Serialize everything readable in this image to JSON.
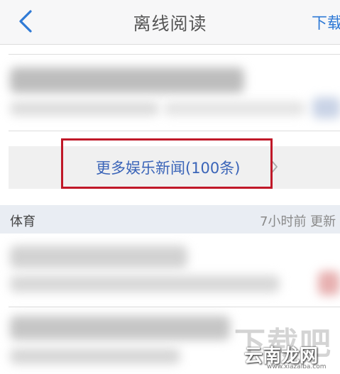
{
  "navbar": {
    "back_icon": "chevron-left-icon",
    "title": "离线阅读",
    "download_label": "下载"
  },
  "more_link": {
    "label": "更多娱乐新闻(100条)",
    "chevron_icon": "chevron-right-icon"
  },
  "section": {
    "title": "体育",
    "meta": "7小时前 更新"
  },
  "watermark": {
    "big_text": "下载吧",
    "main_text": "云南龙网",
    "url": "www.xiazaiba.com"
  },
  "colors": {
    "accent": "#2f7ad6",
    "link": "#3a64b8",
    "highlight_border": "#c01828",
    "section_bg": "#e9edf3"
  }
}
